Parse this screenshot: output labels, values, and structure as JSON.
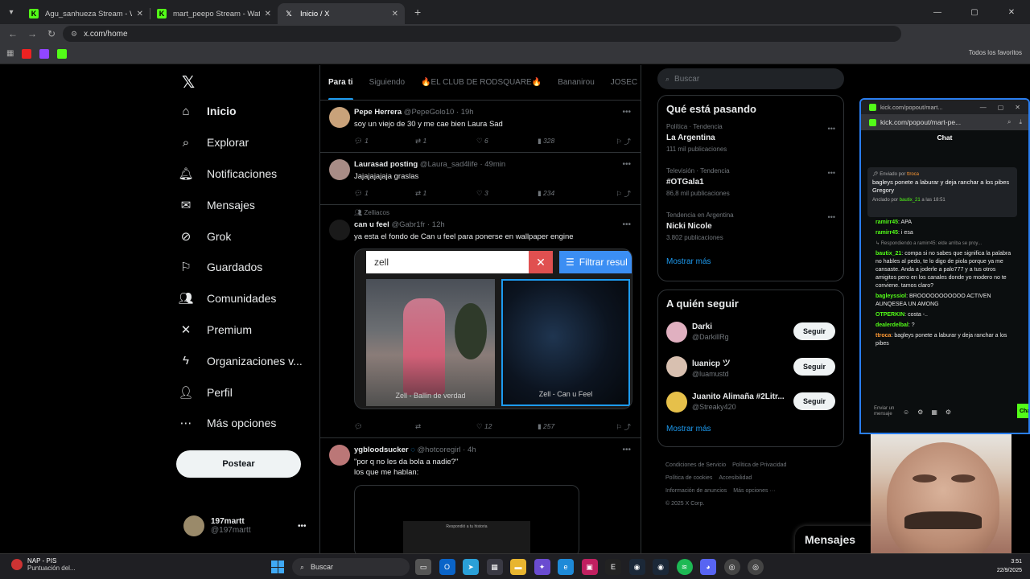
{
  "browser": {
    "tabs": [
      {
        "title": "Agu_sanhueza Stream - Watch Live",
        "favicon": "kick-icon",
        "active": false
      },
      {
        "title": "mart_peepo Stream - Watch Live",
        "favicon": "kick-icon",
        "active": false
      },
      {
        "title": "Inicio / X",
        "favicon": "x-icon",
        "active": true
      }
    ],
    "new_tab": "+",
    "url": "x.com/home",
    "bookmarks_label": "Todos los favoritos"
  },
  "x": {
    "nav": [
      {
        "label": "Inicio",
        "icon": "home-icon",
        "glyph": "⌂"
      },
      {
        "label": "Explorar",
        "icon": "search-icon",
        "glyph": "⌕"
      },
      {
        "label": "Notificaciones",
        "icon": "bell-icon",
        "glyph": "🔔︎"
      },
      {
        "label": "Mensajes",
        "icon": "envelope-icon",
        "glyph": "✉"
      },
      {
        "label": "Grok",
        "icon": "grok-icon",
        "glyph": "⊘"
      },
      {
        "label": "Guardados",
        "icon": "bookmark-icon",
        "glyph": "⚐"
      },
      {
        "label": "Comunidades",
        "icon": "communities-icon",
        "glyph": "👥︎"
      },
      {
        "label": "Premium",
        "icon": "x-icon",
        "glyph": "✕"
      },
      {
        "label": "Organizaciones v...",
        "icon": "lightning-icon",
        "glyph": "ϟ"
      },
      {
        "label": "Perfil",
        "icon": "person-icon",
        "glyph": "👤︎"
      },
      {
        "label": "Más opciones",
        "icon": "more-circle-icon",
        "glyph": "⋯"
      }
    ],
    "post_button": "Postear",
    "account": {
      "name": "197martt",
      "handle": "@197martt"
    },
    "feed_tabs": [
      "Para ti",
      "Siguiendo",
      "🔥EL CLUB DE RODSQUARE🔥",
      "Bananirou",
      "JOSEC"
    ],
    "tweets": [
      {
        "name": "Pepe Herrera",
        "handle": "@PepeGolo10",
        "time": "19h",
        "text": "soy un viejo de 30 y me cae bien Laura Sad",
        "replies": "1",
        "retweets": "1",
        "likes": "6",
        "views": "328"
      },
      {
        "name": "Laurasad posting",
        "handle": "@Laura_sad4life",
        "time": "49min",
        "text": "Jajajajajaja graslas",
        "replies": "1",
        "retweets": "1",
        "likes": "3",
        "views": "234"
      },
      {
        "context": "Zelliacos",
        "name": "can u feel",
        "handle": "@Gabr1fr",
        "time": "12h",
        "text": "ya esta el fondo de Can u feel para ponerse en wallpaper engine",
        "media_search": "zell",
        "media_filter": "Filtrar resul",
        "media_captions": [
          "Zell - Ballin de verdad",
          "Zell - Can u Feel"
        ],
        "replies": "",
        "retweets": "",
        "likes": "12",
        "views": "257"
      },
      {
        "name": "ygbloodsucker",
        "handle": "@hotcoregirl",
        "time": "4h",
        "text": "\"por q no les da bola a nadie?\"",
        "text2": "los que me hablan:",
        "mini_caption": "Respondió a tu historia"
      }
    ],
    "search_placeholder": "Buscar",
    "trends_title": "Qué está pasando",
    "trends": [
      {
        "category": "Política · Tendencia",
        "name": "La Argentina",
        "count": "111 mil publicaciones"
      },
      {
        "category": "Televisión · Tendencia",
        "name": "#OTGala1",
        "count": "86,8 mil publicaciones"
      },
      {
        "category": "Tendencia en Argentina",
        "name": "Nicki Nicole",
        "count": "3.802 publicaciones"
      }
    ],
    "show_more": "Mostrar más",
    "follow_title": "A quién seguir",
    "follow": [
      {
        "name": "Darki",
        "handle": "@DarkillRg",
        "button": "Seguir"
      },
      {
        "name": "luanicp ツ",
        "handle": "@luamustd",
        "button": "Seguir"
      },
      {
        "name": "Juanito Alimaña #2Litr...",
        "handle": "@Streaky420",
        "button": "Seguir"
      }
    ],
    "show_more_2": "Mostrar más",
    "footer_links": [
      "Condiciones de Servicio",
      "Política de Privacidad",
      "Política de cookies",
      "Accesibilidad",
      "Información de anuncios",
      "Más opciones ···",
      "© 2025 X Corp."
    ],
    "messages_label": "Mensajes"
  },
  "kick": {
    "window_title": "kick.com/popout/mart...",
    "url": "kick.com/popout/mart-pe...",
    "chat_header": "Chat",
    "pinned_sent_by": "Enviado por",
    "pinned_sender": "ttroca",
    "pinned_text": "bagleys ponete a laburar y deja ranchar a los pibes Gregory",
    "pinned_by": "Anclado por",
    "pinned_by_user": "bautix_21",
    "pinned_time": "a las 18:51",
    "messages": [
      {
        "user": "ramirr45",
        "text": "APA",
        "color": "#53fc18"
      },
      {
        "user": "ramirr45",
        "text": "i esa",
        "color": "#53fc18"
      },
      {
        "user": "",
        "text": "Respondiendo a ramirr45: elde arriba se proy...",
        "color": "#888888"
      },
      {
        "user": "bautix_21",
        "text": "compa si no sabes que significa la palabra no hables al pedo, te lo digo de piola porque ya me cansaste. Anda a joderle a palo777 y a tus otros amigitos pero en los canales donde yo modero no te conviene. tamos claro?",
        "color": "#53fc18"
      },
      {
        "user": "bagleyssiol",
        "text": "BROOOOOOOOOOO ACTIVEN AUNQESEA UN AMONG",
        "color": "#53fc18"
      },
      {
        "user": "OTPERKIN",
        "text": "costa -..",
        "color": "#53fc18"
      },
      {
        "user": "dealerdelbal",
        "text": "?",
        "color": "#53fc18"
      },
      {
        "user": "ttroca",
        "text": "bagleys ponete a laburar y deja ranchar a los pibes",
        "color": "#ff9933"
      }
    ],
    "input_placeholder": "Enviar un mensaje",
    "send_label": "Cha"
  },
  "taskbar": {
    "weather_title": "NAP - PIS",
    "weather_sub": "Puntuación del...",
    "search_label": "Buscar",
    "time": "3:51",
    "date": "22/9/2025"
  },
  "colors": {
    "accent": "#1d9bf0",
    "kick_green": "#53fc18",
    "background": "#000000"
  }
}
